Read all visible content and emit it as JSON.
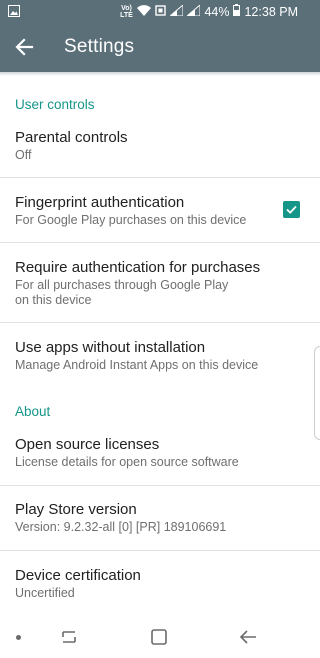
{
  "status_bar": {
    "battery_percent": "44%",
    "time": "12:38 PM",
    "volte_label": "Vo) LTE",
    "icons": [
      "image-icon",
      "volte-icon",
      "wifi-icon",
      "sync-icon",
      "signal-icon",
      "signal-icon",
      "battery-icon"
    ]
  },
  "app_bar": {
    "title": "Settings",
    "back_icon": "arrow-back-icon",
    "color": "#5b6f79"
  },
  "accent_color": "#169688",
  "sections": {
    "user_controls": {
      "header": "User controls",
      "parental": {
        "title": "Parental controls",
        "subtitle": "Off"
      },
      "fingerprint": {
        "title": "Fingerprint authentication",
        "subtitle": "For Google Play purchases on this device",
        "checked": true
      },
      "require_auth": {
        "title": "Require authentication for purchases",
        "subtitle_line1": "For all purchases through Google Play",
        "subtitle_line2": "on this device"
      },
      "instant_apps": {
        "title": "Use apps without installation",
        "subtitle": "Manage Android Instant Apps on this device"
      }
    },
    "about": {
      "header": "About",
      "licenses": {
        "title": "Open source licenses",
        "subtitle": "License details for open source software"
      },
      "version": {
        "title": "Play Store version",
        "subtitle": "Version: 9.2.32-all [0] [PR] 189106691"
      },
      "certification": {
        "title": "Device certification",
        "subtitle": "Uncertified"
      }
    }
  },
  "nav_bar": {
    "icons": [
      "dot-icon",
      "recent-apps-icon",
      "home-icon",
      "back-icon"
    ]
  }
}
